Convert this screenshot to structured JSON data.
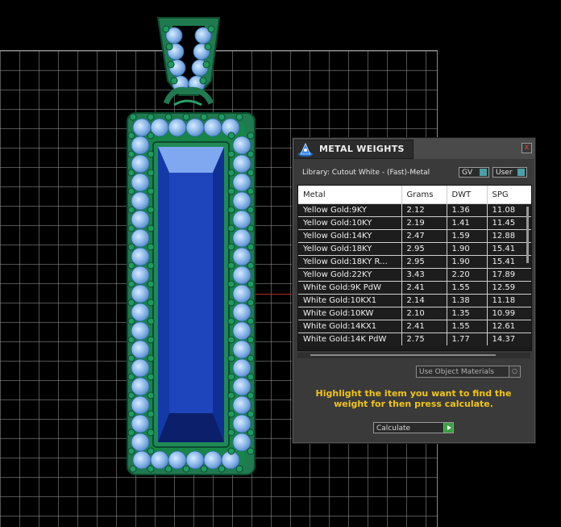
{
  "panel": {
    "title": "METAL WEIGHTS",
    "close_label": "x",
    "library_label": "Library: Cutout White - (Fast)-Metal",
    "gv_label": "GV",
    "user_label": "User",
    "columns": [
      "Metal",
      "Grams",
      "DWT",
      "SPG"
    ],
    "rows": [
      [
        "Yellow Gold:9KY",
        "2.12",
        "1.36",
        "11.08"
      ],
      [
        "Yellow Gold:10KY",
        "2.19",
        "1.41",
        "11.45"
      ],
      [
        "Yellow Gold:14KY",
        "2.47",
        "1.59",
        "12.88"
      ],
      [
        "Yellow Gold:18KY",
        "2.95",
        "1.90",
        "15.41"
      ],
      [
        "Yellow Gold:18KY R...",
        "2.95",
        "1.90",
        "15.41"
      ],
      [
        "Yellow Gold:22KY",
        "3.43",
        "2.20",
        "17.89"
      ],
      [
        "White Gold:9K PdW",
        "2.41",
        "1.55",
        "12.59"
      ],
      [
        "White Gold:10KX1",
        "2.14",
        "1.38",
        "11.18"
      ],
      [
        "White Gold:10KW",
        "2.10",
        "1.35",
        "10.99"
      ],
      [
        "White Gold:14KX1",
        "2.41",
        "1.55",
        "12.61"
      ],
      [
        "White Gold:14K PdW",
        "2.75",
        "1.77",
        "14.37"
      ]
    ],
    "use_object_materials_label": "Use Object Materials",
    "help_text": "Highlight the item you want to find the weight for then press calculate.",
    "calculate_label": "Calculate"
  },
  "colors": {
    "help_text": "#f0c419",
    "metal_green": "#1f7a50",
    "stone_blue": "#1e3fb0",
    "diamond": "#9fc6f0",
    "axis_red": "#b0262a"
  }
}
